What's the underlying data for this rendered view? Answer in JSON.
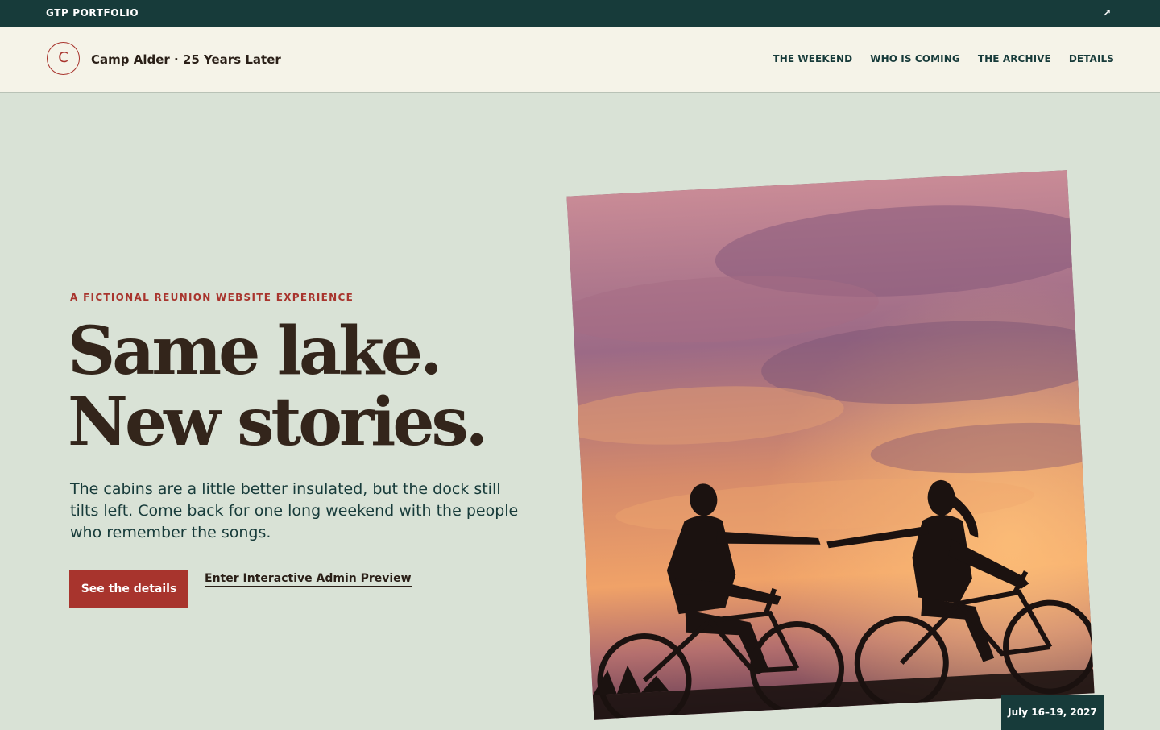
{
  "topbar": {
    "brand": "GTP PORTFOLIO",
    "external_icon": "external-link-icon",
    "external_glyph": "↗"
  },
  "header": {
    "logo_letter": "C",
    "site_title": "Camp Alder · 25 Years Later",
    "nav": [
      {
        "label": "THE WEEKEND"
      },
      {
        "label": "WHO IS COMING"
      },
      {
        "label": "THE ARCHIVE"
      },
      {
        "label": "DETAILS"
      }
    ]
  },
  "hero": {
    "eyebrow": "A FICTIONAL REUNION WEBSITE EXPERIENCE",
    "headline_line1": "Same lake.",
    "headline_line2": "New stories.",
    "lede": "The cabins are a little better insulated, but the dock still tilts left. Come back for one long weekend with the people who remember the songs.",
    "primary_cta": "See the details",
    "secondary_cta": "Enter Interactive Admin Preview",
    "date_badge": "July 16–19, 2027"
  },
  "colors": {
    "topbar_bg": "#173b3a",
    "header_bg": "#f5f3e8",
    "page_bg": "#d9e2d6",
    "accent_red": "#a8342d",
    "headline_brown": "#33251b"
  }
}
